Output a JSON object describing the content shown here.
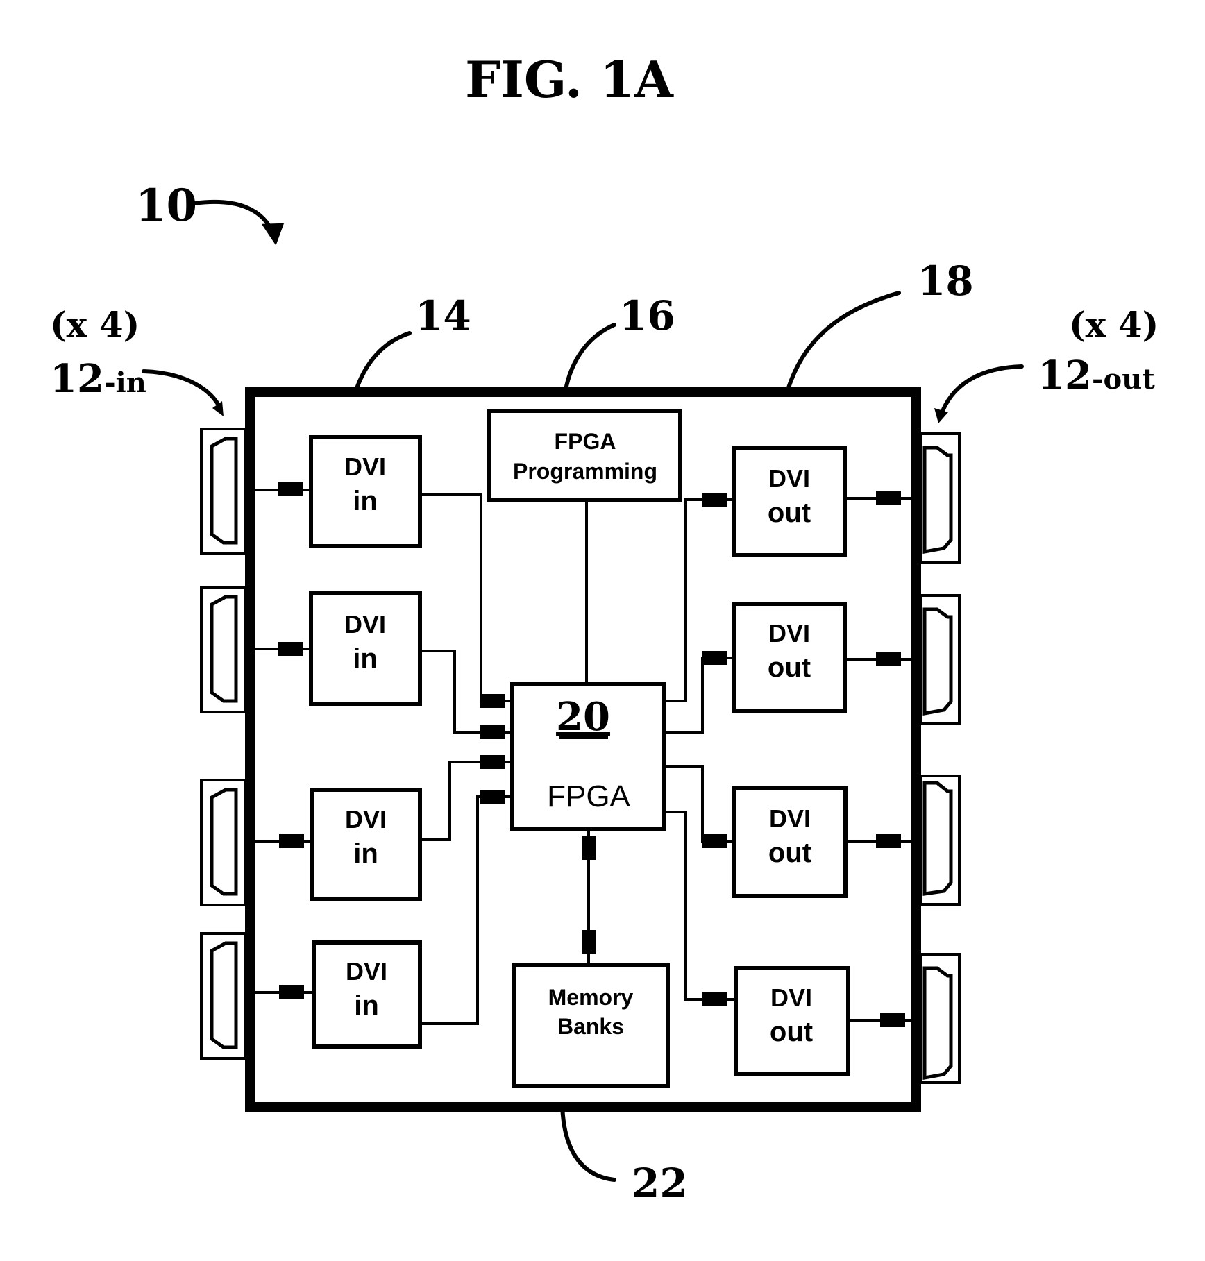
{
  "figure": {
    "title": "FIG. 1A",
    "ref_system": "10",
    "ref_in_connectors": {
      "number": "12",
      "suffix": "-in",
      "multiplier": "(x 4)"
    },
    "ref_out_connectors": {
      "number": "12",
      "suffix": "-out",
      "multiplier": "(x 4)"
    },
    "ref_dvi_in": "14",
    "ref_fpga_programming": "16",
    "ref_dvi_out": "18",
    "ref_fpga": "20",
    "ref_memory": "22"
  },
  "blocks": {
    "fpga_programming": {
      "line1": "FPGA",
      "line2": "Programming"
    },
    "fpga": {
      "number": "20",
      "label": "FPGA"
    },
    "memory": {
      "line1": "Memory",
      "line2": "Banks"
    },
    "dvi_in": [
      {
        "line1": "DVI",
        "line2": "in"
      },
      {
        "line1": "DVI",
        "line2": "in"
      },
      {
        "line1": "DVI",
        "line2": "in"
      },
      {
        "line1": "DVI",
        "line2": "in"
      }
    ],
    "dvi_out": [
      {
        "line1": "DVI",
        "line2": "out"
      },
      {
        "line1": "DVI",
        "line2": "out"
      },
      {
        "line1": "DVI",
        "line2": "out"
      },
      {
        "line1": "DVI",
        "line2": "out"
      }
    ]
  }
}
